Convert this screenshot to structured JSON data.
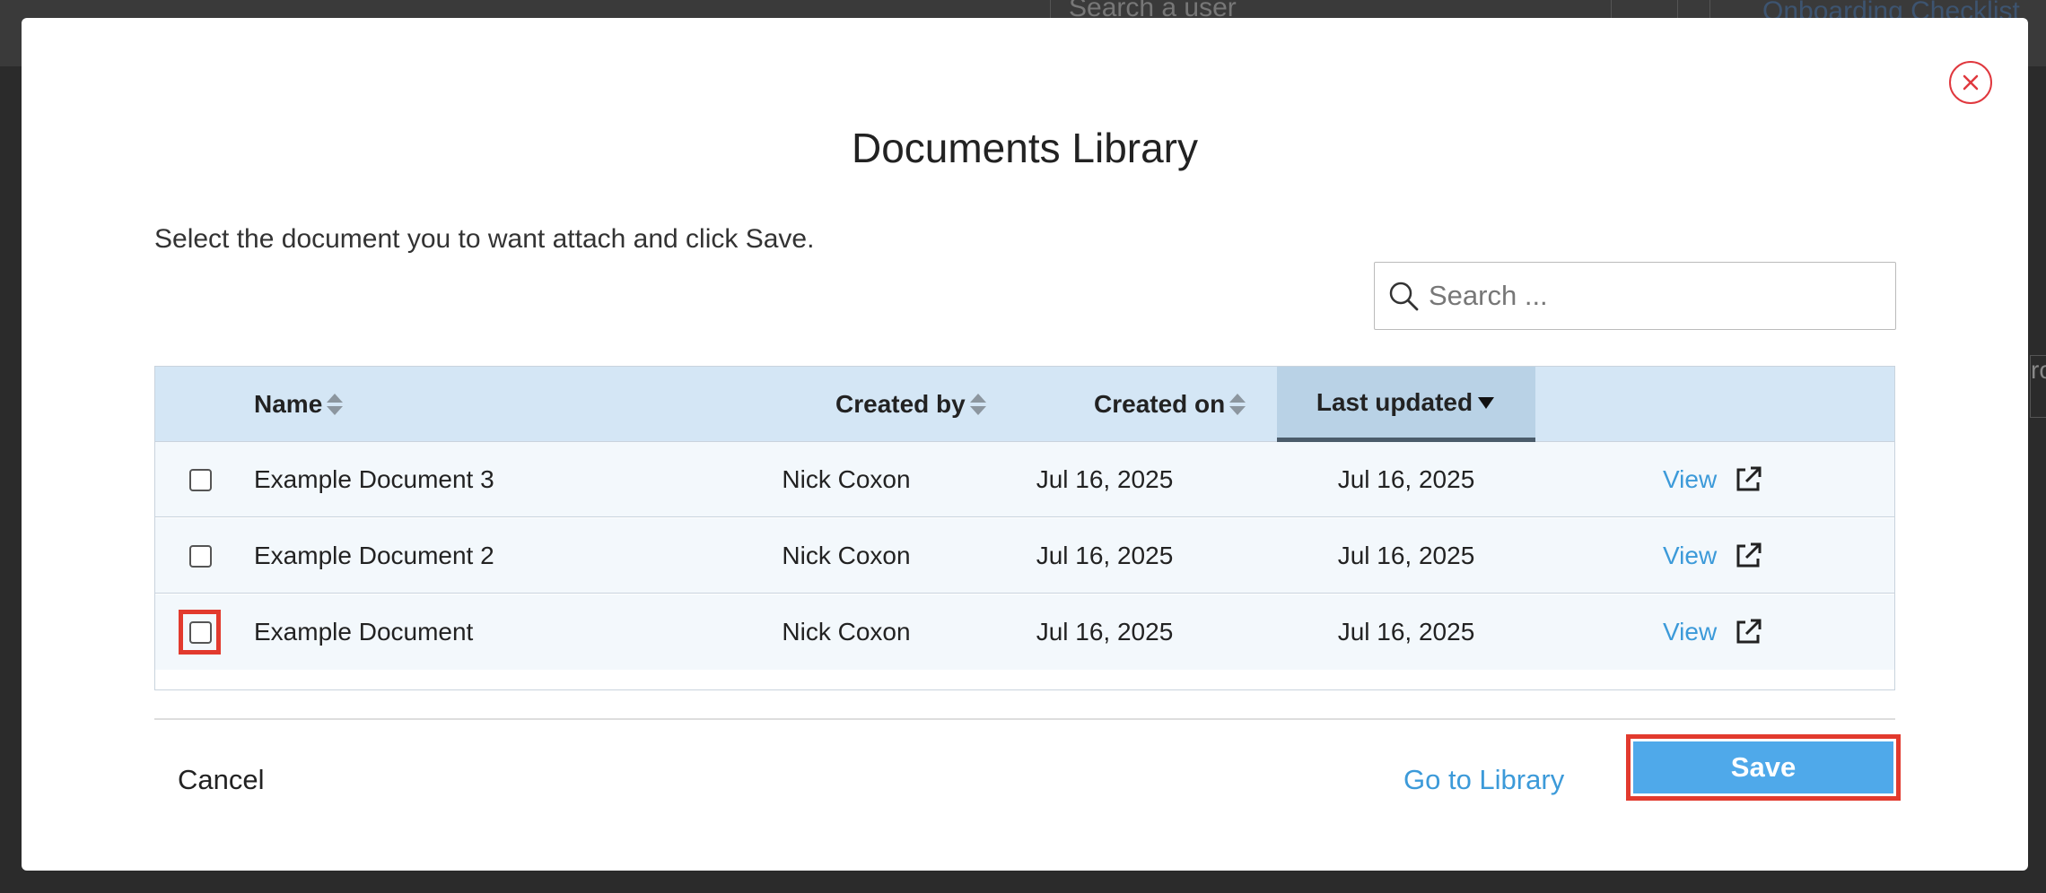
{
  "background": {
    "search_placeholder": "Search a user",
    "link_text": "Onboarding Checklist",
    "edge_text": "ro"
  },
  "modal": {
    "title": "Documents Library",
    "instructions": "Select the document you to want attach and click Save.",
    "search_placeholder": "Search ...",
    "table": {
      "columns": {
        "name": "Name",
        "created_by": "Created by",
        "created_on": "Created on",
        "last_updated": "Last updated"
      },
      "rows": [
        {
          "name": "Example Document 3",
          "created_by": "Nick Coxon",
          "created_on": "Jul 16, 2025",
          "last_updated": "Jul 16, 2025",
          "view": "View"
        },
        {
          "name": "Example Document 2",
          "created_by": "Nick Coxon",
          "created_on": "Jul 16, 2025",
          "last_updated": "Jul 16, 2025",
          "view": "View"
        },
        {
          "name": "Example Document",
          "created_by": "Nick Coxon",
          "created_on": "Jul 16, 2025",
          "last_updated": "Jul 16, 2025",
          "view": "View"
        }
      ]
    },
    "footer": {
      "cancel": "Cancel",
      "go_to_library": "Go to Library",
      "save": "Save"
    }
  },
  "colors": {
    "accent": "#4fa9ea",
    "link": "#3c9ad9",
    "header_bg": "#d4e6f5",
    "highlight": "#e23a2e",
    "close": "#e0383e"
  },
  "icons": {
    "close": "close-icon",
    "search": "search-icon",
    "sort": "sort-both-icon",
    "sort_desc": "caret-down-icon",
    "external": "external-link-icon"
  }
}
